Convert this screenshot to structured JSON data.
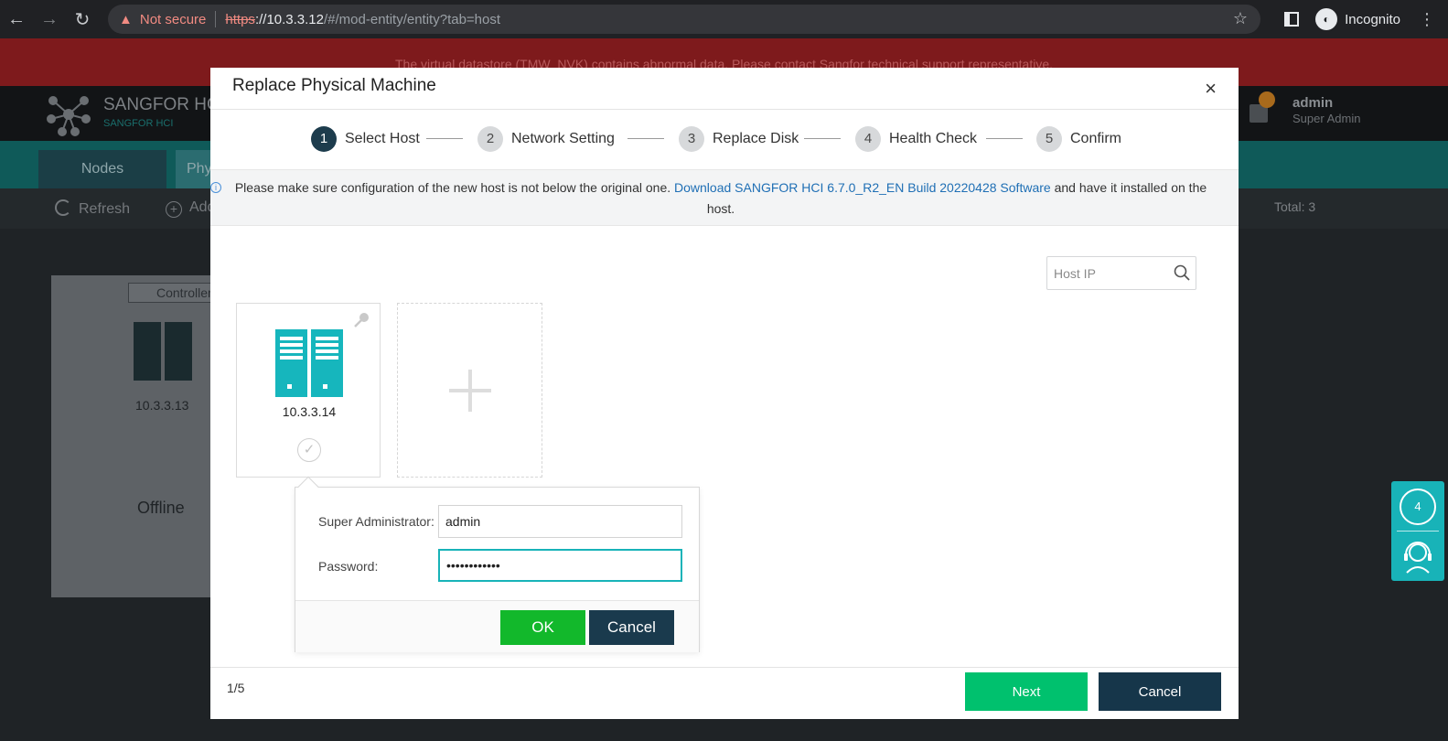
{
  "browser": {
    "security_label": "Not secure",
    "url_scheme": "https",
    "url_host": "://10.3.3.12",
    "url_path": "/#/mod-entity/entity?tab=host",
    "profile_label": "Incognito"
  },
  "background": {
    "alert_banner": "The virtual datastore (TMW_NVK) contains abnormal data. Please contact Sangfor technical support representative.",
    "brand": "SANGFOR HC",
    "brand_sub": "SANGFOR HCI",
    "user_name": "admin",
    "user_role": "Super Admin",
    "tabs": [
      "Nodes",
      "Phy"
    ],
    "toolbar": {
      "refresh": "Refresh",
      "add": "Add"
    },
    "total": "Total: 3",
    "card": {
      "tag": "Controller",
      "ip": "10.3.3.13",
      "status": "Offline"
    }
  },
  "float_widget": {
    "badge_count": "4"
  },
  "modal": {
    "title": "Replace Physical Machine",
    "close_glyph": "×",
    "steps": [
      {
        "num": "1",
        "label": "Select Host"
      },
      {
        "num": "2",
        "label": "Network Setting"
      },
      {
        "num": "3",
        "label": "Replace Disk"
      },
      {
        "num": "4",
        "label": "Health Check"
      },
      {
        "num": "5",
        "label": "Confirm"
      }
    ],
    "active_step": 1,
    "info": {
      "prefix": "Please make sure configuration of the new host is not below the original one. ",
      "link": "Download SANGFOR HCI 6.7.0_R2_EN Build 20220428 Software",
      "suffix": " and have it installed on the host."
    },
    "search": {
      "placeholder": "Host IP"
    },
    "host_card": {
      "ip": "10.3.3.14",
      "check_glyph": "✓"
    },
    "popover": {
      "admin_label": "Super Administrator:",
      "admin_value": "admin",
      "password_label": "Password:",
      "password_value": "••••••••••••",
      "ok": "OK",
      "cancel": "Cancel"
    },
    "footer": {
      "page_indicator": "1/5",
      "next": "Next",
      "cancel": "Cancel"
    }
  },
  "colors": {
    "accent": "#18b3b8",
    "active_step": "#1d3c4d",
    "ok_button": "#12b82b",
    "next_button": "#00c16e",
    "dark_button": "#16364a",
    "link": "#1f6fb5"
  }
}
